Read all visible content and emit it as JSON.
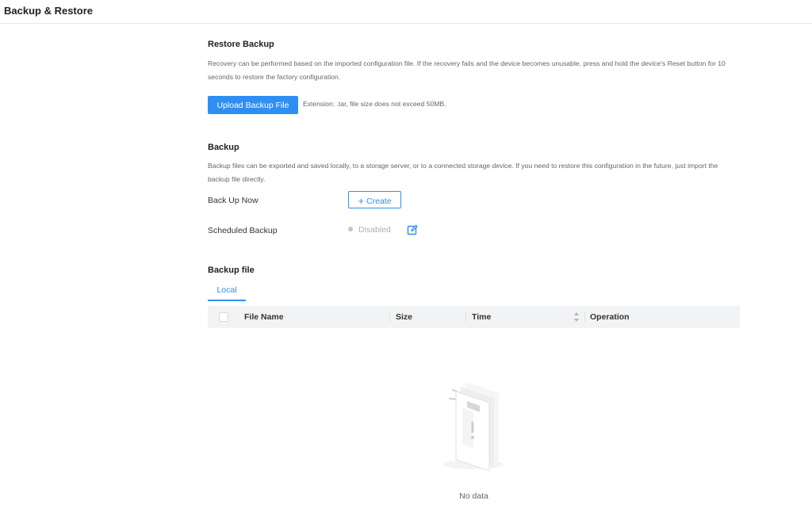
{
  "header": {
    "title": "Backup & Restore"
  },
  "restore": {
    "title": "Restore Backup",
    "description": "Recovery can be performed based on the imported configuration file. If the recovery fails and the device becomes unusable, press and hold the device's Reset button for 10 seconds to restore the factory configuration.",
    "upload_label": "Upload Backup File",
    "hint": "Extension: .tar, file size does not exceed 50MB."
  },
  "backup": {
    "title": "Backup",
    "description": "Backup files can be exported and saved locally, to a storage server, or to a connected storage device. If you need to restore this configuration in the future, just import the backup file directly.",
    "back_up_now_label": "Back Up Now",
    "create_label": "Create",
    "scheduled_label": "Scheduled Backup",
    "scheduled_status": "Disabled"
  },
  "backup_file": {
    "title": "Backup file",
    "tabs": [
      {
        "label": "Local",
        "active": true
      }
    ],
    "columns": [
      "File Name",
      "Size",
      "Time",
      "Operation"
    ],
    "rows": [],
    "empty_text": "No data"
  },
  "colors": {
    "accent": "#2f8ef4",
    "table_header_bg": "#f2f3f5",
    "disabled_text": "#b0b0b0"
  },
  "icons": {
    "create": "plus-icon",
    "edit": "edit-icon",
    "sort": "sort-icon",
    "empty": "empty-document-illustration"
  }
}
